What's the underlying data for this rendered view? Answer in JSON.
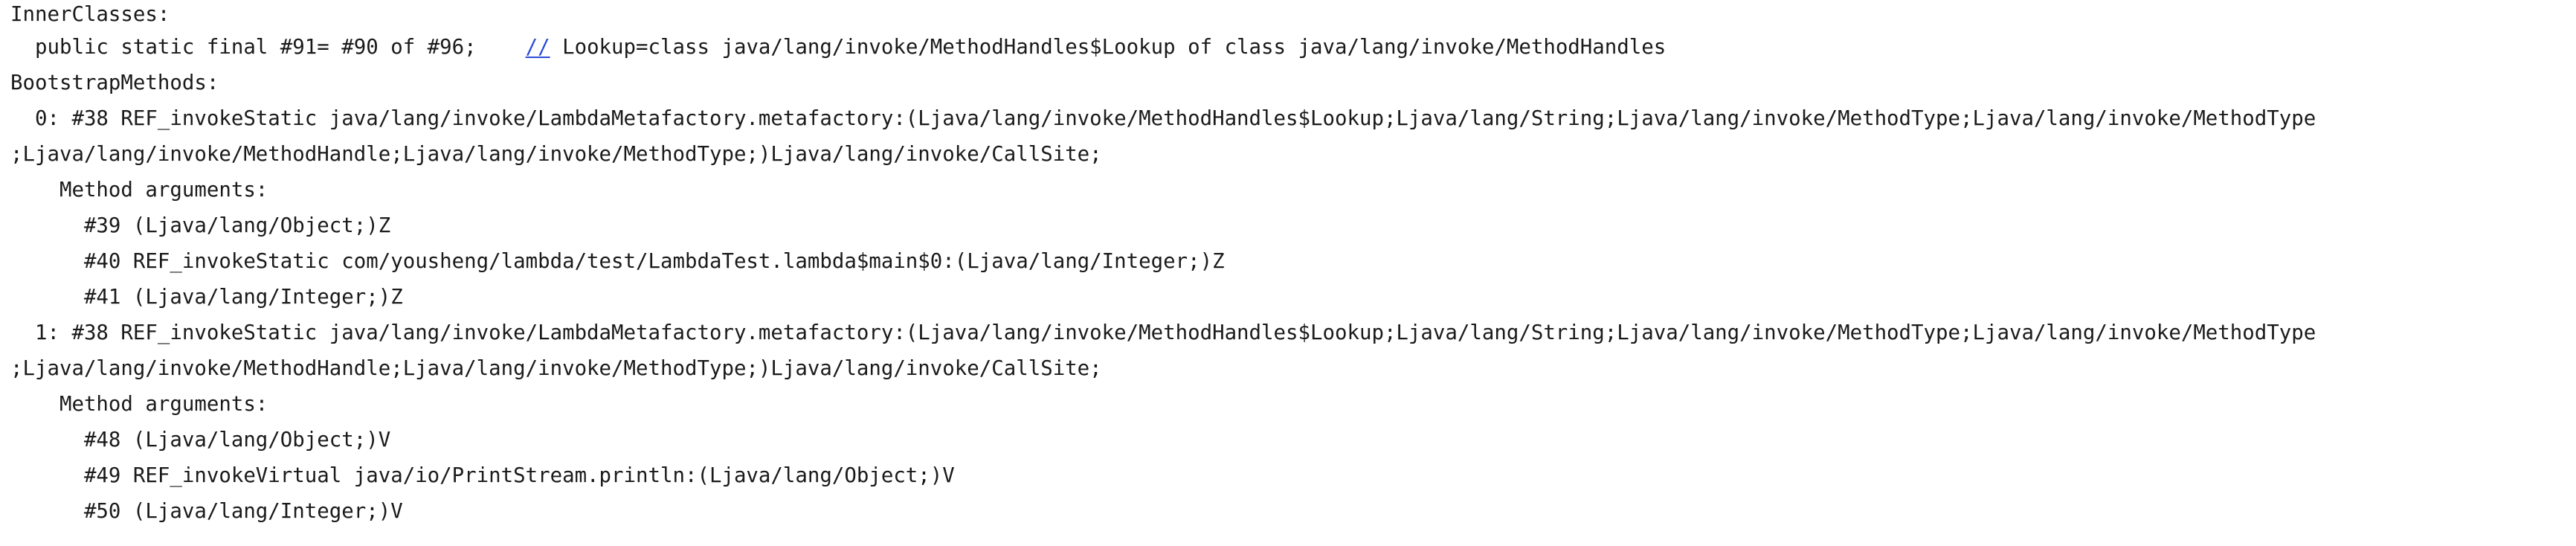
{
  "console": {
    "line0": "InnerClasses:",
    "line1_pre": "  public static final #91= #90 of #96;    ",
    "line1_link": "//",
    "line1_post": " Lookup=class java/lang/invoke/MethodHandles$Lookup of class java/lang/invoke/MethodHandles",
    "line2": "BootstrapMethods:",
    "line3": "  0: #38 REF_invokeStatic java/lang/invoke/LambdaMetafactory.metafactory:(Ljava/lang/invoke/MethodHandles$Lookup;Ljava/lang/String;Ljava/lang/invoke/MethodType;Ljava/lang/invoke/MethodType",
    "line4": ";Ljava/lang/invoke/MethodHandle;Ljava/lang/invoke/MethodType;)Ljava/lang/invoke/CallSite;",
    "line5": "    Method arguments:",
    "line6": "      #39 (Ljava/lang/Object;)Z",
    "line7": "      #40 REF_invokeStatic com/yousheng/lambda/test/LambdaTest.lambda$main$0:(Ljava/lang/Integer;)Z",
    "line8": "      #41 (Ljava/lang/Integer;)Z",
    "line9": "  1: #38 REF_invokeStatic java/lang/invoke/LambdaMetafactory.metafactory:(Ljava/lang/invoke/MethodHandles$Lookup;Ljava/lang/String;Ljava/lang/invoke/MethodType;Ljava/lang/invoke/MethodType",
    "line10": ";Ljava/lang/invoke/MethodHandle;Ljava/lang/invoke/MethodType;)Ljava/lang/invoke/CallSite;",
    "line11": "    Method arguments:",
    "line12": "      #48 (Ljava/lang/Object;)V",
    "line13": "      #49 REF_invokeVirtual java/io/PrintStream.println:(Ljava/lang/Object;)V",
    "line14": "      #50 (Ljava/lang/Integer;)V"
  }
}
